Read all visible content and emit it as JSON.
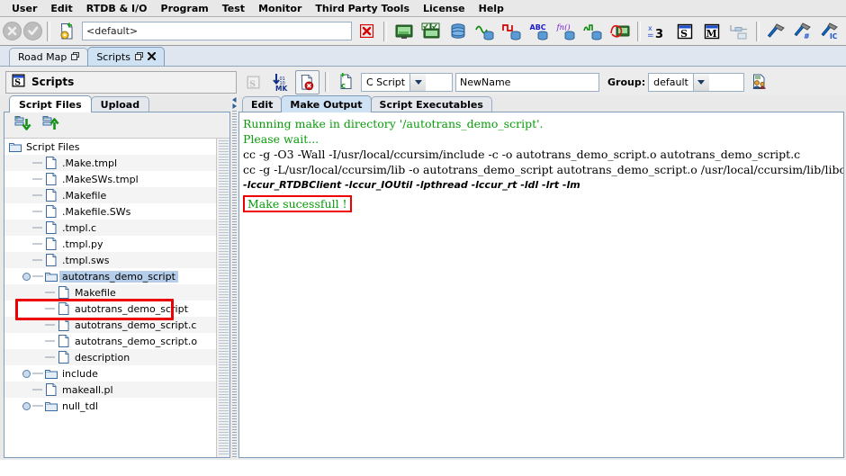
{
  "menubar": {
    "items": [
      {
        "label": "User"
      },
      {
        "label": "Edit"
      },
      {
        "label": "RTDB & I/O"
      },
      {
        "label": "Program"
      },
      {
        "label": "Test"
      },
      {
        "label": "Monitor"
      },
      {
        "label": "Third Party Tools"
      },
      {
        "label": "License"
      },
      {
        "label": "Help"
      }
    ]
  },
  "toolbar": {
    "address_value": "<default>",
    "buttons": [
      {
        "name": "stop-button",
        "icon": "circle-x-icon"
      },
      {
        "name": "ok-button",
        "icon": "circle-check-icon"
      },
      {
        "name": "new-document-button",
        "icon": "new-document-icon"
      },
      {
        "name": "close-address-button",
        "icon": "red-x-icon"
      },
      {
        "name": "display-button",
        "icon": "monitor-icon"
      },
      {
        "name": "displays-button",
        "icon": "monitor-checklist-icon"
      },
      {
        "name": "database-button",
        "icon": "database-icon"
      },
      {
        "name": "analog-signal-button",
        "icon": "sine-database-icon"
      },
      {
        "name": "digital-signal-button",
        "icon": "square-wave-database-icon"
      },
      {
        "name": "string-signal-button",
        "icon": "abc-database-icon"
      },
      {
        "name": "function-button",
        "icon": "fn-database-icon"
      },
      {
        "name": "pulse-button",
        "icon": "pulse-database-icon"
      },
      {
        "name": "scope-button",
        "icon": "scope-monitor-icon"
      },
      {
        "name": "variable-button",
        "icon": "x-equals-3-icon"
      },
      {
        "name": "scripts-window-button",
        "icon": "s-window-icon"
      },
      {
        "name": "models-window-button",
        "icon": "m-window-icon"
      },
      {
        "name": "connection-button",
        "icon": "connector-icon"
      },
      {
        "name": "tools-button",
        "icon": "hammer-icon"
      },
      {
        "name": "tools-config-button",
        "icon": "hammer-hash-icon"
      },
      {
        "name": "tools-ic-button",
        "icon": "hammer-ic-icon"
      }
    ]
  },
  "window_tabs": [
    {
      "label": "Road Map",
      "active": false,
      "closable": false
    },
    {
      "label": "Scripts",
      "active": true,
      "closable": true
    }
  ],
  "panel": {
    "title": "Scripts",
    "title_icon": "s-window-icon",
    "script_type_value": "C Script",
    "script_name_value": "NewName",
    "group_label": "Group:",
    "group_value": "default",
    "buttons": [
      {
        "name": "scripts-disabled-button",
        "icon": "s-disabled-icon"
      },
      {
        "name": "make-button",
        "icon": "download-mk-icon"
      },
      {
        "name": "delete-script-button",
        "icon": "document-delete-icon"
      },
      {
        "name": "new-c-script-button",
        "icon": "new-c-document-icon"
      },
      {
        "name": "group-users-button",
        "icon": "users-group-icon"
      }
    ]
  },
  "left_panel": {
    "tabs": [
      {
        "label": "Script Files",
        "active": true
      },
      {
        "label": "Upload",
        "active": false
      }
    ],
    "tools": [
      {
        "name": "download-files-button",
        "icon": "import-down-icon"
      },
      {
        "name": "upload-files-button",
        "icon": "export-up-icon"
      }
    ],
    "tree": [
      {
        "label": "Script Files",
        "type": "folder",
        "depth": 0,
        "knob": "none",
        "selected": false,
        "annotated": false
      },
      {
        "label": ".Make.tmpl",
        "type": "file",
        "depth": 1,
        "knob": "none",
        "selected": false,
        "annotated": false
      },
      {
        "label": ".MakeSWs.tmpl",
        "type": "file",
        "depth": 1,
        "knob": "none",
        "selected": false,
        "annotated": false
      },
      {
        "label": ".Makefile",
        "type": "file",
        "depth": 1,
        "knob": "none",
        "selected": false,
        "annotated": false
      },
      {
        "label": ".Makefile.SWs",
        "type": "file",
        "depth": 1,
        "knob": "none",
        "selected": false,
        "annotated": false
      },
      {
        "label": ".tmpl.c",
        "type": "file",
        "depth": 1,
        "knob": "none",
        "selected": false,
        "annotated": false
      },
      {
        "label": ".tmpl.py",
        "type": "file",
        "depth": 1,
        "knob": "none",
        "selected": false,
        "annotated": false
      },
      {
        "label": ".tmpl.sws",
        "type": "file",
        "depth": 1,
        "knob": "none",
        "selected": false,
        "annotated": false
      },
      {
        "label": "autotrans_demo_script",
        "type": "folder",
        "depth": 1,
        "knob": "expanded",
        "selected": true,
        "annotated": false
      },
      {
        "label": "Makefile",
        "type": "file",
        "depth": 2,
        "knob": "none",
        "selected": false,
        "annotated": false
      },
      {
        "label": "autotrans_demo_script",
        "type": "file",
        "depth": 2,
        "knob": "none",
        "selected": false,
        "annotated": true
      },
      {
        "label": "autotrans_demo_script.c",
        "type": "file",
        "depth": 2,
        "knob": "none",
        "selected": false,
        "annotated": false
      },
      {
        "label": "autotrans_demo_script.o",
        "type": "file",
        "depth": 2,
        "knob": "none",
        "selected": false,
        "annotated": false
      },
      {
        "label": "description",
        "type": "file",
        "depth": 2,
        "knob": "none",
        "selected": false,
        "annotated": false
      },
      {
        "label": "include",
        "type": "folder",
        "depth": 1,
        "knob": "collapsed",
        "selected": false,
        "annotated": false
      },
      {
        "label": "makeall.pl",
        "type": "file",
        "depth": 1,
        "knob": "none",
        "selected": false,
        "annotated": false
      },
      {
        "label": "null_tdl",
        "type": "folder",
        "depth": 1,
        "knob": "collapsed",
        "selected": false,
        "annotated": false
      }
    ]
  },
  "editor": {
    "tabs": [
      {
        "label": "Edit",
        "active": false
      },
      {
        "label": "Make Output",
        "active": true
      },
      {
        "label": "Script Executables",
        "active": false
      }
    ],
    "output_lines": [
      {
        "text": "Running make in directory '/autotrans_demo_script'.",
        "style": "green"
      },
      {
        "text": "Please wait...",
        "style": "green"
      },
      {
        "text": "cc -g -O3 -Wall -I/usr/local/ccursim/include -c -o autotrans_demo_script.o autotrans_demo_script.c",
        "style": "plain"
      },
      {
        "text": "cc -g -L/usr/local/ccursim/lib -o autotrans_demo_script autotrans_demo_script.o  /usr/local/ccursim/lib/libccur_sim.a",
        "style": "plain"
      },
      {
        "text": "-lccur_RTDBClient -lccur_IOUtil -lpthread -lccur_rt -ldl -lrt -lm",
        "style": "bolditalic"
      },
      {
        "text": "Make sucessfull !",
        "style": "highlight-green"
      }
    ]
  },
  "colors": {
    "accent": "#0a9b0a",
    "annotation": "#ee0000",
    "selection": "#b5cde8",
    "tab_active": "#cfe2f3"
  }
}
